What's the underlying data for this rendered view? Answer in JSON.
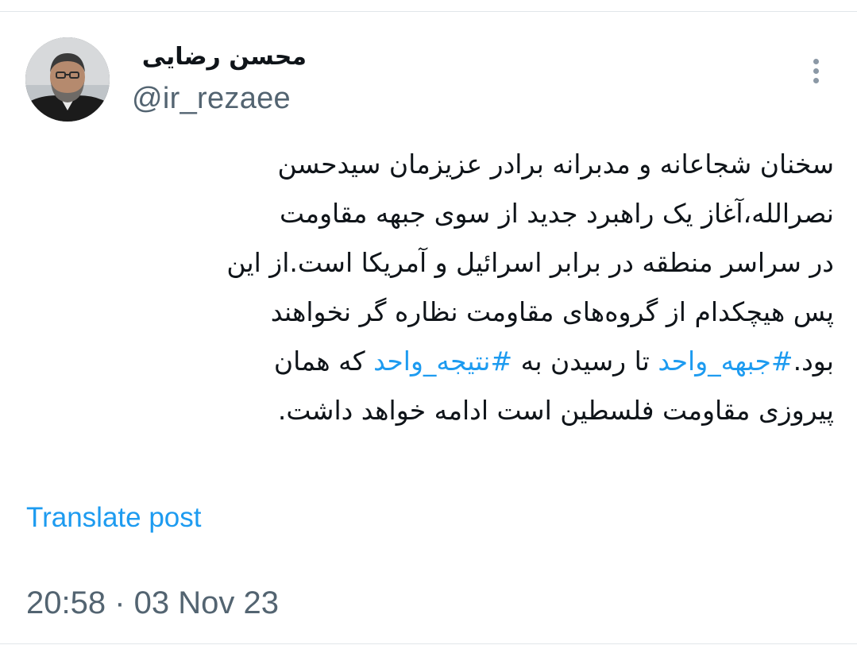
{
  "tweet": {
    "author": {
      "display_name": "محسن رضایی",
      "handle": "@ir_rezaee"
    },
    "text": {
      "line1": "سخنان شجاعانه و مدبرانه برادر عزیزمان سیدحسن",
      "line2": "نصرالله،آغاز یک راهبرد جدید از سوی جبهه مقاومت",
      "line3": "در سراسر منطقه در برابر اسرائیل و آمریکا است.از این",
      "line4": "پس هیچکدام از گروه‌های مقاومت نظاره گر نخواهند",
      "line5_part1": "بود.",
      "line5_hashtag1": "#جبهه_واحد",
      "line5_part2": " تا رسیدن به ",
      "line5_hashtag2": "#نتیجه_واحد",
      "line5_part3": " که همان",
      "line6": "پیروزی مقاومت فلسطین است ادامه خواهد داشت."
    },
    "translate_label": "Translate post",
    "timestamp": "20:58 · 03 Nov 23"
  },
  "icons": {
    "more": "more-vertical-icon"
  },
  "colors": {
    "link": "#1d9bf0",
    "secondary_text": "#536471",
    "primary_text": "#0f1419",
    "divider": "#e1e6ea"
  }
}
